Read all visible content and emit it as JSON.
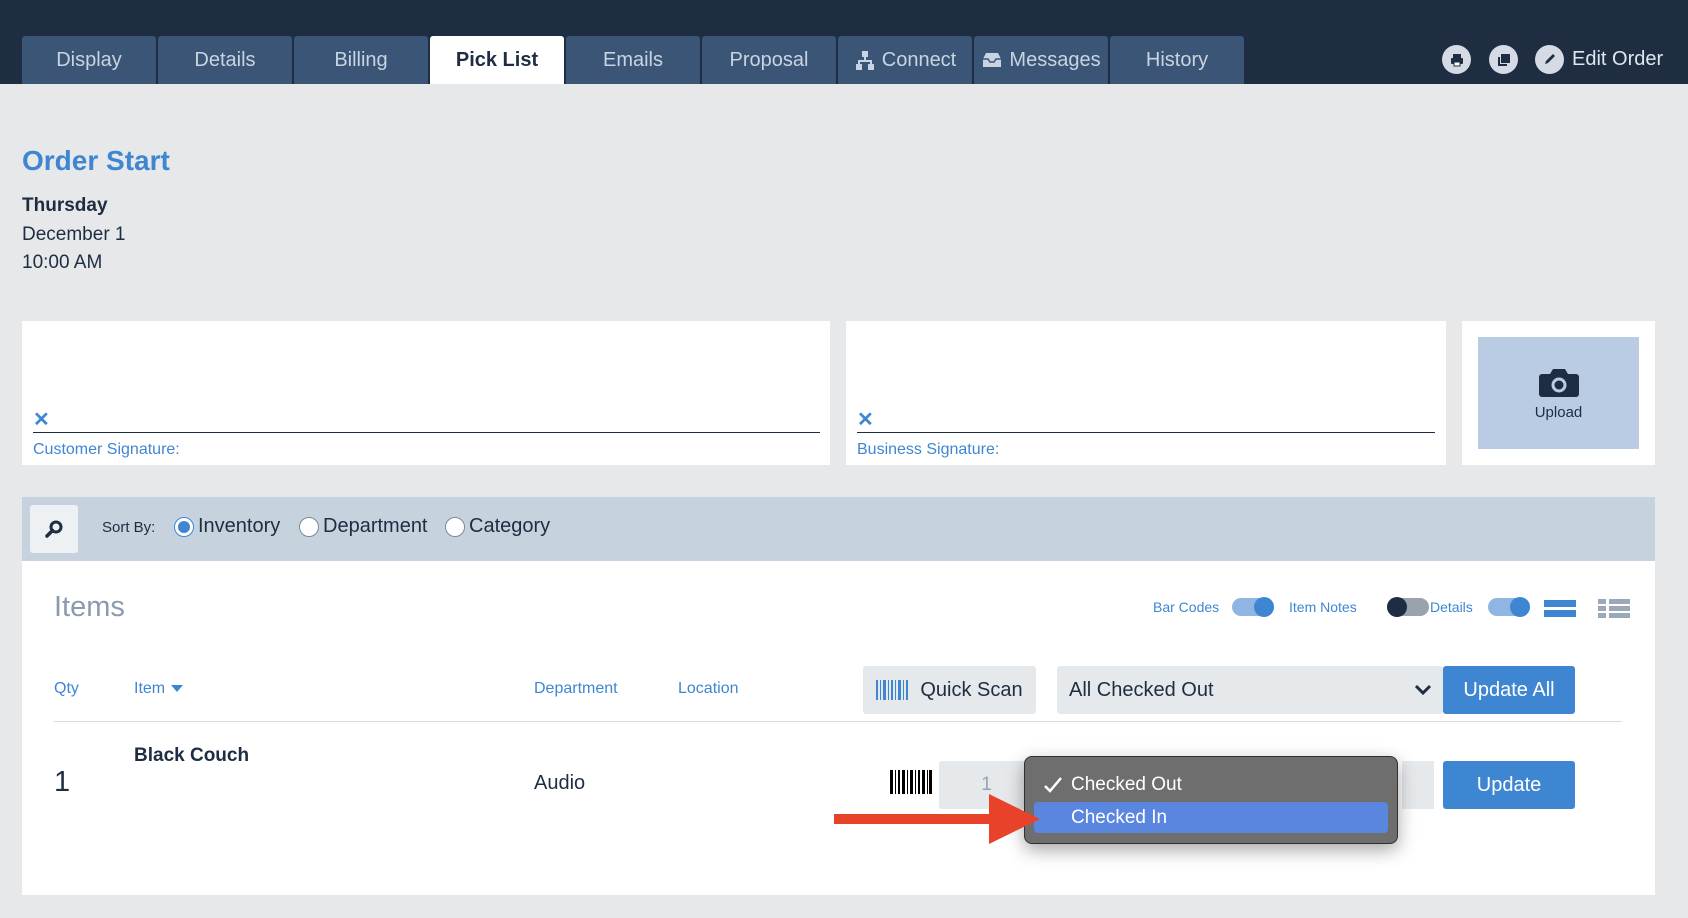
{
  "tabs": [
    {
      "label": "Display"
    },
    {
      "label": "Details"
    },
    {
      "label": "Billing"
    },
    {
      "label": "Pick List",
      "active": true
    },
    {
      "label": "Emails"
    },
    {
      "label": "Proposal"
    },
    {
      "label": "Connect",
      "icon": "connect-icon"
    },
    {
      "label": "Messages",
      "icon": "inbox-icon"
    },
    {
      "label": "History"
    }
  ],
  "header_actions": {
    "print_icon": "print-icon",
    "copy_icon": "copy-icon",
    "edit_label": "Edit Order",
    "edit_icon": "pencil-icon"
  },
  "order": {
    "title": "Order Start",
    "day": "Thursday",
    "date": "December 1",
    "time": "10:00 AM"
  },
  "signatures": {
    "customer_label": "Customer Signature:",
    "business_label": "Business Signature:",
    "clear_glyph": "✕",
    "upload_label": "Upload",
    "upload_icon": "camera-icon"
  },
  "filter": {
    "search_icon": "search-icon",
    "sort_by_label": "Sort By:",
    "options": [
      {
        "label": "Inventory",
        "checked": true
      },
      {
        "label": "Department",
        "checked": false
      },
      {
        "label": "Category",
        "checked": false
      }
    ]
  },
  "items": {
    "title": "Items",
    "toggles": [
      {
        "label": "Bar Codes",
        "on": true
      },
      {
        "label": "Item Notes",
        "on": false
      },
      {
        "label": "Details",
        "on": true
      }
    ],
    "view_icons": [
      "list-view-icon",
      "compact-list-icon"
    ],
    "columns": {
      "qty": "Qty",
      "item": "Item",
      "department": "Department",
      "location": "Location"
    },
    "quick_scan_label": "Quick Scan",
    "status_select_value": "All Checked Out",
    "update_all_label": "Update All",
    "rows": [
      {
        "qty": "1",
        "name": "Black Couch",
        "department": "Audio",
        "scan_qty": "1",
        "update_label": "Update"
      }
    ]
  },
  "dropdown": {
    "options": [
      {
        "label": "Checked Out",
        "checked": true
      },
      {
        "label": "Checked In",
        "highlighted": true
      }
    ]
  },
  "colors": {
    "accent": "#3f86d2",
    "topbar": "#1e2d42",
    "tab": "#3a5576",
    "arrow": "#e8422b",
    "highlight": "#5b86df"
  }
}
